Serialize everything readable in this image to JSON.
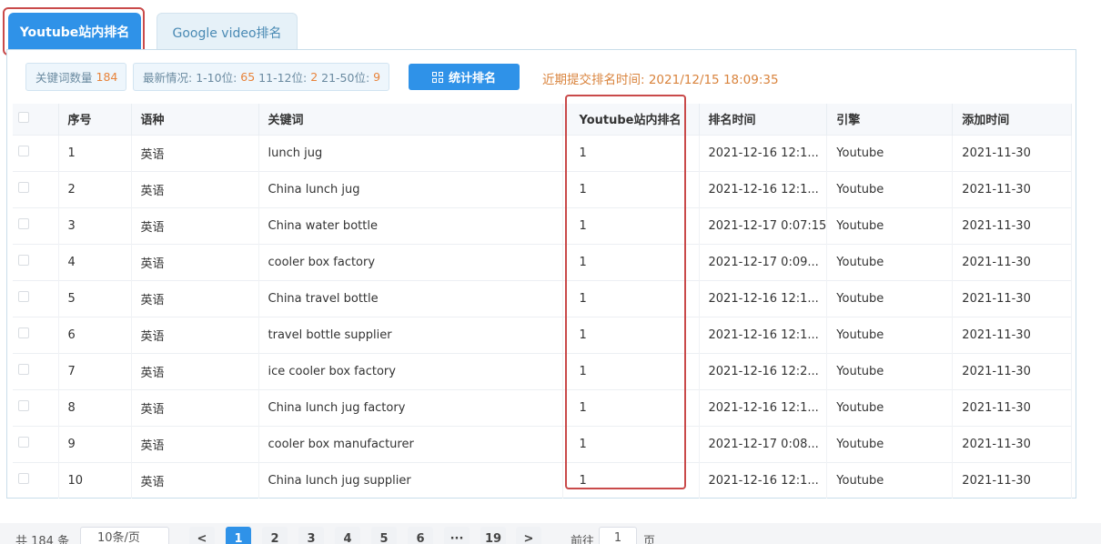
{
  "tabs": [
    {
      "label": "Youtube站内排名"
    },
    {
      "label": "Google video排名"
    }
  ],
  "toolbar": {
    "keyword_count_label": "关键词数量",
    "keyword_count_value": "184",
    "latest_label": "最新情况:",
    "range1_label": "1-10位:",
    "range1_value": "65",
    "range2_label": "11-12位:",
    "range2_value": "2",
    "range3_label": "21-50位:",
    "range3_value": "9",
    "stat_button_label": "统计排名",
    "recent_submit_text": "近期提交排名时间: 2021/12/15 18:09:35"
  },
  "table": {
    "headers": [
      "序号",
      "语种",
      "关键词",
      "Youtube站内排名",
      "排名时间",
      "引擎",
      "添加时间"
    ],
    "rows": [
      {
        "no": "1",
        "lang": "英语",
        "keyword": "lunch jug",
        "rank": "1",
        "rank_time": "2021-12-16 12:1...",
        "engine": "Youtube",
        "added": "2021-11-30"
      },
      {
        "no": "2",
        "lang": "英语",
        "keyword": "China lunch jug",
        "rank": "1",
        "rank_time": "2021-12-16 12:1...",
        "engine": "Youtube",
        "added": "2021-11-30"
      },
      {
        "no": "3",
        "lang": "英语",
        "keyword": "China water bottle",
        "rank": "1",
        "rank_time": "2021-12-17 0:07:15",
        "engine": "Youtube",
        "added": "2021-11-30"
      },
      {
        "no": "4",
        "lang": "英语",
        "keyword": "cooler box factory",
        "rank": "1",
        "rank_time": "2021-12-17 0:09...",
        "engine": "Youtube",
        "added": "2021-11-30"
      },
      {
        "no": "5",
        "lang": "英语",
        "keyword": "China travel bottle",
        "rank": "1",
        "rank_time": "2021-12-16 12:1...",
        "engine": "Youtube",
        "added": "2021-11-30"
      },
      {
        "no": "6",
        "lang": "英语",
        "keyword": "travel bottle supplier",
        "rank": "1",
        "rank_time": "2021-12-16 12:1...",
        "engine": "Youtube",
        "added": "2021-11-30"
      },
      {
        "no": "7",
        "lang": "英语",
        "keyword": "ice cooler box factory",
        "rank": "1",
        "rank_time": "2021-12-16 12:2...",
        "engine": "Youtube",
        "added": "2021-11-30"
      },
      {
        "no": "8",
        "lang": "英语",
        "keyword": "China lunch jug factory",
        "rank": "1",
        "rank_time": "2021-12-16 12:1...",
        "engine": "Youtube",
        "added": "2021-11-30"
      },
      {
        "no": "9",
        "lang": "英语",
        "keyword": "cooler box manufacturer",
        "rank": "1",
        "rank_time": "2021-12-17 0:08...",
        "engine": "Youtube",
        "added": "2021-11-30"
      },
      {
        "no": "10",
        "lang": "英语",
        "keyword": "China lunch jug supplier",
        "rank": "1",
        "rank_time": "2021-12-16 12:1...",
        "engine": "Youtube",
        "added": "2021-11-30"
      }
    ]
  },
  "pagination": {
    "total_text": "共 184 条",
    "page_size": "10条/页",
    "prev": "<",
    "next": ">",
    "pages": [
      "1",
      "2",
      "3",
      "4",
      "5",
      "6",
      "···",
      "19"
    ],
    "goto_label": "前往",
    "goto_value": "1",
    "goto_unit": "页"
  },
  "colors": {
    "accent": "#2f92e8",
    "highlight": "#c94a4a",
    "orange": "#e8833a"
  }
}
